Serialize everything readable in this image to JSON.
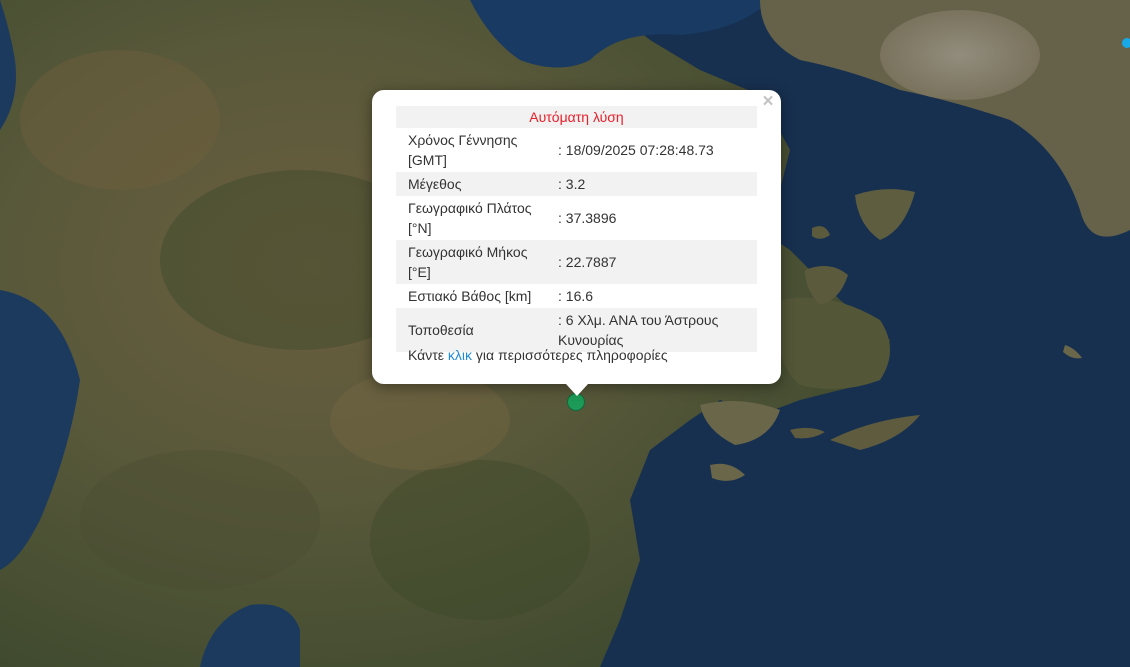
{
  "popup": {
    "title": "Αυτόματη λύση",
    "close_symbol": "×",
    "rows": [
      {
        "label_line1": "Χρόνος Γέννησης",
        "label_line2": "[GMT]",
        "value": ": 18/09/2025 07:28:48.73"
      },
      {
        "label_line1": "Μέγεθος",
        "label_line2": "",
        "value": ": 3.2"
      },
      {
        "label_line1": "Γεωγραφικό Πλάτος",
        "label_line2": "[°N]",
        "value": ": 37.3896"
      },
      {
        "label_line1": "Γεωγραφικό Μήκος",
        "label_line2": "[°E]",
        "value": ": 22.7887"
      },
      {
        "label_line1": "Εστιακό Βάθος [km]",
        "label_line2": "",
        "value": ": 16.6"
      },
      {
        "label_line1": "Τοποθεσία",
        "label_line2": "",
        "value_line1": ": 6 Χλμ. ΑΝΑ του Άστρους",
        "value_line2": "Κυνουρίας"
      }
    ],
    "more_prefix": "Κάντε ",
    "more_link": "κλικ",
    "more_suffix": " για περισσότερες πληροφορίες"
  },
  "map": {
    "marker_color": "#1d9a57",
    "edge_marker_color": "#19a9e6",
    "sea_color": "#17304f",
    "land_color": "#5b5a3c"
  }
}
